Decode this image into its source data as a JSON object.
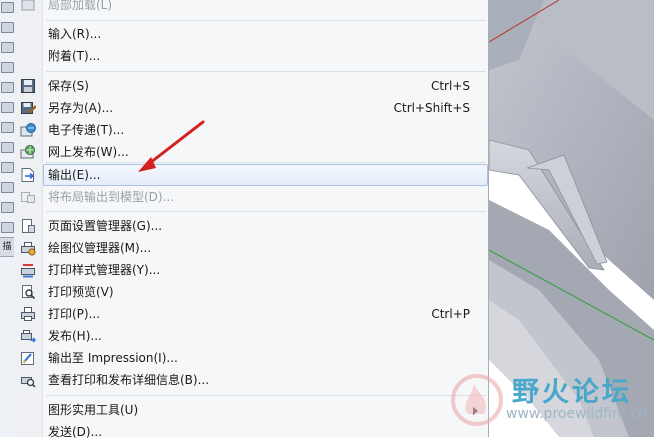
{
  "left_strip": {
    "tag_label": "描"
  },
  "menu": {
    "items": [
      {
        "label": "局部加载(L)",
        "shortcut": "",
        "icon": "partial-load-icon",
        "disabled": true
      },
      {
        "label": "输入(R)...",
        "shortcut": "",
        "icon": "",
        "disabled": false
      },
      {
        "label": "附着(T)...",
        "shortcut": "",
        "icon": "",
        "disabled": false
      },
      {
        "label": "保存(S)",
        "shortcut": "Ctrl+S",
        "icon": "save-icon",
        "disabled": false
      },
      {
        "label": "另存为(A)...",
        "shortcut": "Ctrl+Shift+S",
        "icon": "save-as-icon",
        "disabled": false
      },
      {
        "label": "电子传递(T)...",
        "shortcut": "",
        "icon": "etransmit-icon",
        "disabled": false
      },
      {
        "label": "网上发布(W)...",
        "shortcut": "",
        "icon": "publish-web-icon",
        "disabled": false
      },
      {
        "label": "输出(E)...",
        "shortcut": "",
        "icon": "export-icon",
        "disabled": false
      },
      {
        "label": "将布局输出到模型(D)...",
        "shortcut": "",
        "icon": "export-layout-icon",
        "disabled": true
      },
      {
        "label": "页面设置管理器(G)...",
        "shortcut": "",
        "icon": "page-setup-icon",
        "disabled": false
      },
      {
        "label": "绘图仪管理器(M)...",
        "shortcut": "",
        "icon": "plotter-manager-icon",
        "disabled": false
      },
      {
        "label": "打印样式管理器(Y)...",
        "shortcut": "",
        "icon": "plot-style-icon",
        "disabled": false
      },
      {
        "label": "打印预览(V)",
        "shortcut": "",
        "icon": "print-preview-icon",
        "disabled": false
      },
      {
        "label": "打印(P)...",
        "shortcut": "Ctrl+P",
        "icon": "print-icon",
        "disabled": false
      },
      {
        "label": "发布(H)...",
        "shortcut": "",
        "icon": "publish-icon",
        "disabled": false
      },
      {
        "label": "输出至 Impression(I)...",
        "shortcut": "",
        "icon": "impression-icon",
        "disabled": false
      },
      {
        "label": "查看打印和发布详细信息(B)...",
        "shortcut": "",
        "icon": "plot-details-icon",
        "disabled": false
      },
      {
        "label": "图形实用工具(U)",
        "shortcut": "",
        "icon": "",
        "disabled": false
      },
      {
        "label": "发送(D)...",
        "shortcut": "",
        "icon": "",
        "disabled": false
      }
    ]
  },
  "watermark": {
    "title": "野火论坛",
    "url": "www.proewildfire.cn"
  },
  "colors": {
    "annotation_arrow": "#d42020",
    "highlight_border": "#a9c1e3",
    "viewport_axis_red": "#b83030",
    "viewport_axis_green": "#2e9e3a",
    "watermark_text": "#49a8c9"
  }
}
